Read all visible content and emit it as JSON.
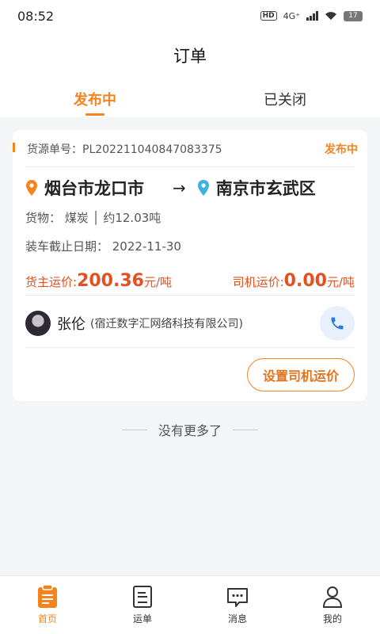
{
  "status_bar": {
    "time": "08:52",
    "hd": "HD",
    "network": "4G⁺",
    "battery": "17"
  },
  "header": {
    "title": "订单"
  },
  "tabs": [
    {
      "label": "发布中",
      "active": true
    },
    {
      "label": "已关闭",
      "active": false
    }
  ],
  "order": {
    "order_no_label": "货源单号：",
    "order_no": "PL202211040847083375",
    "status": "发布中",
    "from_city": "烟台市龙口市",
    "arrow": "→",
    "to_city": "南京市玄武区",
    "cargo": "货物： 煤炭 │ 约12.03吨",
    "deadline": "装车截止日期： 2022-11-30",
    "shipper_price_label": "货主运价:",
    "shipper_price": "200.36",
    "shipper_price_unit": "元/吨",
    "driver_price_label": "司机运价:",
    "driver_price": "0.00",
    "driver_price_unit": "元/吨",
    "driver_name": "张伦",
    "company": "(宿迁数字汇网络科技有限公司)",
    "set_price_button": "设置司机运价"
  },
  "footer_text": "没有更多了",
  "bottom_nav": [
    {
      "label": "首页",
      "icon": "home-doc-icon",
      "active": true
    },
    {
      "label": "运单",
      "icon": "waybill-icon",
      "active": false
    },
    {
      "label": "消息",
      "icon": "message-icon",
      "active": false
    },
    {
      "label": "我的",
      "icon": "profile-icon",
      "active": false
    }
  ],
  "colors": {
    "accent": "#f5841f",
    "price": "#e4501f",
    "phone": "#2a7ae2"
  }
}
